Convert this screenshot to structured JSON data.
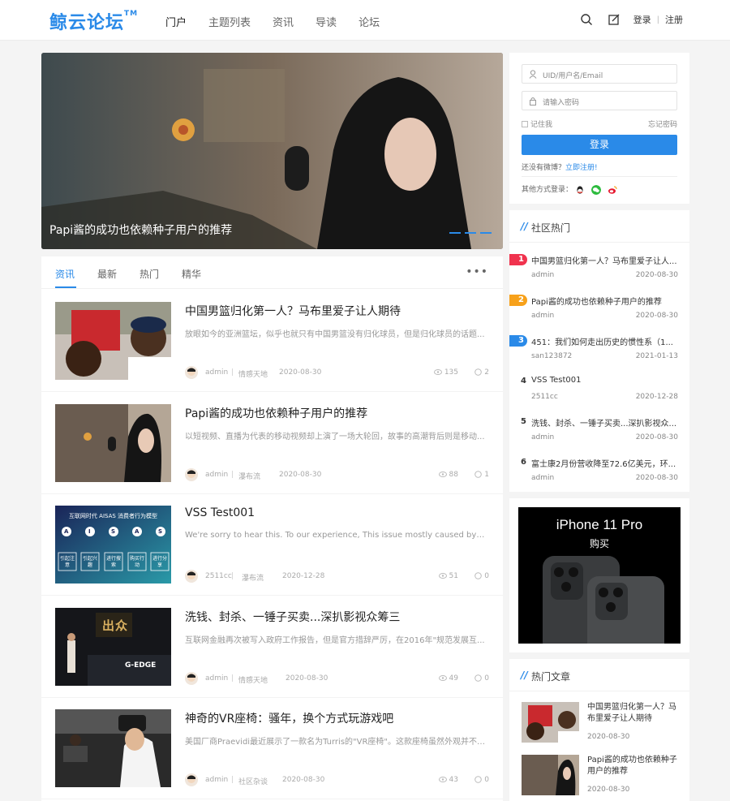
{
  "header": {
    "logo": "鲸云论坛",
    "logo_tm": "TM",
    "nav": [
      "门户",
      "主题列表",
      "资讯",
      "导读",
      "论坛"
    ],
    "login": "登录",
    "register": "注册"
  },
  "slider": {
    "caption": "Papi酱的成功也依赖种子用户的推荐"
  },
  "tabs": [
    "资讯",
    "最新",
    "热门",
    "精华"
  ],
  "articles": [
    {
      "title": "中国男篮归化第一人？马布里爱子让人期待",
      "excerpt": "放眼如今的亚洲篮坛，似乎也就只有中国男篮没有归化球员，但是归化球员的话题...",
      "author": "admin",
      "category": "情感天地",
      "date": "2020-08-30",
      "views": "135",
      "comments": "2"
    },
    {
      "title": "Papi酱的成功也依赖种子用户的推荐",
      "excerpt": "以短视频、直播为代表的移动视频却上演了一场大轮回，故事的高潮背后则是移动...",
      "author": "admin",
      "category": "瀑布流",
      "date": "2020-08-30",
      "views": "88",
      "comments": "1"
    },
    {
      "title": "VSS Test001",
      "excerpt": "We're sorry to hear this. To our experience, This issue mostly caused by the built-i...",
      "author": "2511cc",
      "category": "瀑布流",
      "date": "2020-12-28",
      "views": "51",
      "comments": "0"
    },
    {
      "title": "洗钱、封杀、一锤子买卖...深扒影视众筹三",
      "excerpt": "互联网金融再次被写入政府工作报告，但是官方措辞严厉，在2016年\"规范发展互...",
      "author": "admin",
      "category": "情感天地",
      "date": "2020-08-30",
      "views": "49",
      "comments": "0"
    },
    {
      "title": "神奇的VR座椅：骚年，换个方式玩游戏吧",
      "excerpt": "美国厂商Praevidi最近展示了一款名为Turris的\"VR座椅\"。这款座椅虽然外观并不起...",
      "author": "admin",
      "category": "社区杂谈",
      "date": "2020-08-30",
      "views": "43",
      "comments": "0"
    }
  ],
  "thumb_texts": {
    "aisas_title": "互联网时代 AISAS 消费者行为模型",
    "aisas_letters": [
      "A",
      "I",
      "S",
      "A",
      "S"
    ],
    "aisas_actions": [
      "引起注意",
      "引起兴趣",
      "进行搜索",
      "购买行动",
      "进行分享"
    ],
    "stage_sign": "出众",
    "stage_brand": "G-EDGE"
  },
  "login": {
    "username_placeholder": "UID/用户名/Email",
    "password_placeholder": "请输入密码",
    "remember": "记住我",
    "forgot": "忘记密码",
    "button": "登录",
    "no_account": "还没有微博？",
    "register_now": "立即注册!",
    "other_methods": "其他方式登录："
  },
  "community": {
    "heading": "社区热门",
    "items": [
      {
        "rank": "1",
        "title": "中国男篮归化第一人？马布里爱子让人...",
        "author": "admin",
        "date": "2020-08-30"
      },
      {
        "rank": "2",
        "title": "Papi酱的成功也依赖种子用户的推荐",
        "author": "admin",
        "date": "2020-08-30"
      },
      {
        "rank": "3",
        "title": "451：我们如何走出历史的惯性系（1...",
        "author": "san123872",
        "date": "2021-01-13"
      },
      {
        "rank": "4",
        "title": "VSS Test001",
        "author": "2511cc",
        "date": "2020-12-28"
      },
      {
        "rank": "5",
        "title": "洗钱、封杀、一锤子买卖...深扒影视众...",
        "author": "admin",
        "date": "2020-08-30"
      },
      {
        "rank": "6",
        "title": "富士康2月份营收降至72.6亿美元，环...",
        "author": "admin",
        "date": "2020-08-30"
      }
    ]
  },
  "ad": {
    "title": "iPhone 11 Pro",
    "buy": "购买"
  },
  "hot_articles": {
    "heading": "热门文章",
    "items": [
      {
        "title": "中国男篮归化第一人？马布里爱子让人期待",
        "date": "2020-08-30"
      },
      {
        "title": "Papi酱的成功也依赖种子用户的推荐",
        "date": "2020-08-30"
      }
    ]
  },
  "colors": {
    "accent": "#2a8ae8",
    "rank1": "#f0334e",
    "rank2": "#f7a11a",
    "rank3": "#2a8ae8"
  }
}
